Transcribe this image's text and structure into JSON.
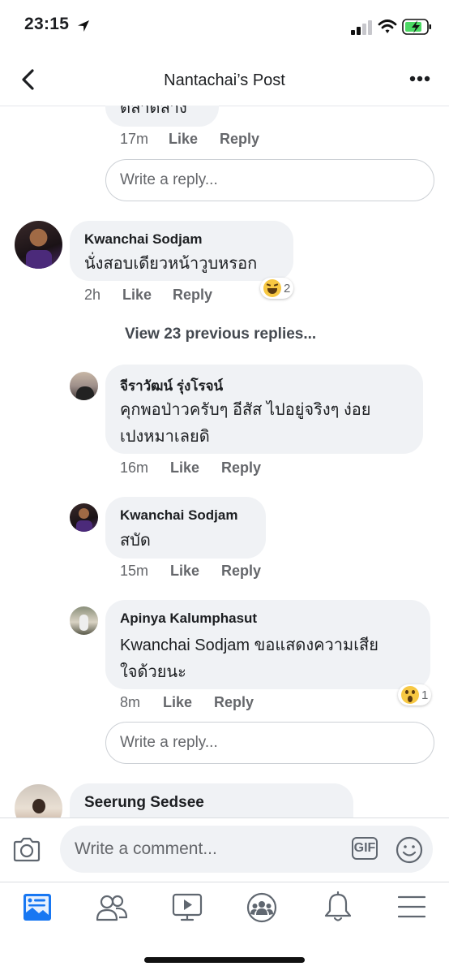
{
  "status_bar": {
    "time": "23:15"
  },
  "header": {
    "title": "Nantachai’s Post"
  },
  "top_partial": {
    "text": "ตลาดล่าง",
    "time": "17m",
    "like": "Like",
    "reply": "Reply"
  },
  "reply_placeholder": "Write a reply...",
  "comment": {
    "author": "Kwanchai Sodjam",
    "text": "นั่งสอบเดียวหน้าวูบหรอก",
    "time": "2h",
    "like": "Like",
    "reply": "Reply",
    "reaction_count": "2"
  },
  "view_previous": "View 23 previous replies...",
  "replies": [
    {
      "author": "จีราวัฒน์ รุ่งโรจน์",
      "text_line1": "คุกพอป่าวครับๆ อีสัส ไปอยู่จริงๆ ง่อย",
      "text_line2": "เปงหมาเลยดิ",
      "time": "16m",
      "like": "Like",
      "reply": "Reply"
    },
    {
      "author": "Kwanchai Sodjam",
      "text": "สบัด",
      "time": "15m",
      "like": "Like",
      "reply": "Reply"
    },
    {
      "author": "Apinya Kalumphasut",
      "text_line1": "Kwanchai Sodjam ขอแสดงความเสีย",
      "text_line2": "ใจด้วยนะ",
      "time": "8m",
      "like": "Like",
      "reply": "Reply",
      "reaction_count": "1"
    }
  ],
  "next_comment": {
    "author": "Seerung Sedsee"
  },
  "composer": {
    "placeholder": "Write a comment...",
    "gif_label": "GIF"
  },
  "colors": {
    "accent": "#1877f2",
    "bubble": "#f0f2f5",
    "secondary_text": "#65676b"
  }
}
